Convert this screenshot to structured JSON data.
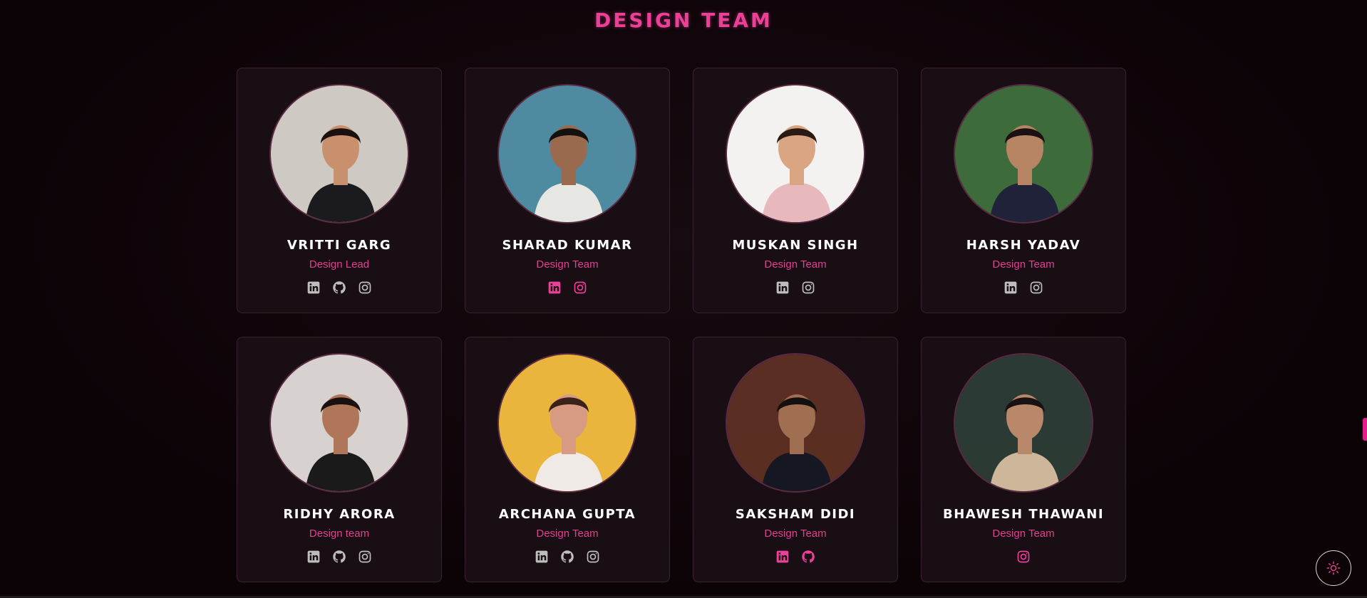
{
  "section": {
    "title": "Design Team"
  },
  "colors": {
    "accent": "#ec3f96",
    "muted_icon": "#bdbdbd",
    "card_bg": "#1a0e15"
  },
  "members": [
    {
      "name": "Vritti Garg",
      "role": "Design Lead",
      "socials": [
        "linkedin-icon",
        "github-icon",
        "instagram-icon"
      ],
      "socials_highlighted": false,
      "photo_bg": "#cfc9c4",
      "photo_shirt": "#1b1b1f",
      "photo_skin": "#c8906c",
      "photo_hair": "#1a1010"
    },
    {
      "name": "Sharad Kumar",
      "role": "Design Team",
      "socials": [
        "linkedin-icon",
        "instagram-icon"
      ],
      "socials_highlighted": true,
      "photo_bg": "#4f8aa0",
      "photo_shirt": "#e6e6e2",
      "photo_skin": "#9a6a4e",
      "photo_hair": "#151010"
    },
    {
      "name": "Muskan Singh",
      "role": "Design Team",
      "socials": [
        "linkedin-icon",
        "instagram-icon"
      ],
      "socials_highlighted": false,
      "photo_bg": "#f4f2f1",
      "photo_shirt": "#e7b9bd",
      "photo_skin": "#d9a583",
      "photo_hair": "#2a1a14"
    },
    {
      "name": "Harsh Yadav",
      "role": "Design Team",
      "socials": [
        "linkedin-icon",
        "instagram-icon"
      ],
      "socials_highlighted": false,
      "photo_bg": "#3d6b3b",
      "photo_shirt": "#1f2238",
      "photo_skin": "#b78563",
      "photo_hair": "#1a1212"
    },
    {
      "name": "Ridhy Arora",
      "role": "Design team",
      "socials": [
        "linkedin-icon",
        "github-icon",
        "instagram-icon"
      ],
      "socials_highlighted": false,
      "photo_bg": "#d7d2cf",
      "photo_shirt": "#1a1a1a",
      "photo_skin": "#b0765a",
      "photo_hair": "#1a1010"
    },
    {
      "name": "Archana Gupta",
      "role": "Design Team",
      "socials": [
        "linkedin-icon",
        "github-icon",
        "instagram-icon"
      ],
      "socials_highlighted": false,
      "photo_bg": "#e9b53d",
      "photo_shirt": "#efeae6",
      "photo_skin": "#d69b82",
      "photo_hair": "#3a211a"
    },
    {
      "name": "Saksham Didi",
      "role": "Design Team",
      "socials": [
        "linkedin-icon",
        "github-icon"
      ],
      "socials_highlighted": true,
      "photo_bg": "#5a2e22",
      "photo_shirt": "#151822",
      "photo_skin": "#a06e50",
      "photo_hair": "#151010"
    },
    {
      "name": "Bhawesh Thawani",
      "role": "Design Team",
      "socials": [
        "instagram-icon"
      ],
      "socials_highlighted": true,
      "photo_bg": "#2b3a34",
      "photo_shirt": "#cdb69a",
      "photo_skin": "#b9876a",
      "photo_hair": "#1a1212"
    }
  ],
  "theme_toggle": {
    "icon": "sun-icon"
  }
}
